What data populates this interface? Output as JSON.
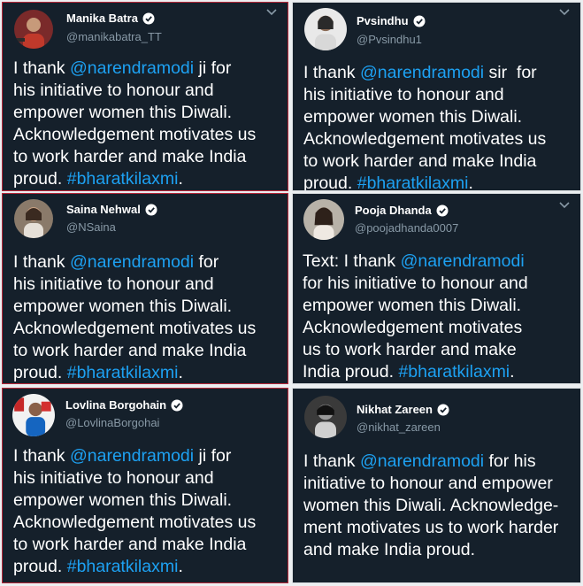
{
  "tweets": [
    {
      "name": "Manika Batra",
      "handle": "@manikabatra_TT",
      "lines": [
        [
          {
            "t": "I thank "
          },
          {
            "t": "@narendramodi",
            "c": "mention"
          },
          {
            "t": " ji for"
          }
        ],
        [
          {
            "t": "his initiative to honour and"
          }
        ],
        [
          {
            "t": "empower women this Diwali."
          }
        ],
        [
          {
            "t": "Acknowledgement motivates us"
          }
        ],
        [
          {
            "t": "to work harder and make India"
          }
        ],
        [
          {
            "t": "proud. "
          },
          {
            "t": "#bharatkilaxmi",
            "c": "hashtag"
          },
          {
            "t": "."
          }
        ]
      ]
    },
    {
      "name": "Pvsindhu",
      "handle": "@Pvsindhu1",
      "lines": [
        [
          {
            "t": "I thank "
          },
          {
            "t": "@narendramodi",
            "c": "mention"
          },
          {
            "t": " sir  for"
          }
        ],
        [
          {
            "t": "his initiative to honour and"
          }
        ],
        [
          {
            "t": "empower women this Diwali."
          }
        ],
        [
          {
            "t": "Acknowledgement motivates us"
          }
        ],
        [
          {
            "t": "to work harder and make India"
          }
        ],
        [
          {
            "t": "proud. "
          },
          {
            "t": "#bharatkilaxmi",
            "c": "hashtag"
          },
          {
            "t": "."
          }
        ]
      ]
    },
    {
      "name": "Saina Nehwal",
      "handle": "@NSaina",
      "lines": [
        [
          {
            "t": "I thank "
          },
          {
            "t": "@narendramodi",
            "c": "mention"
          },
          {
            "t": " for"
          }
        ],
        [
          {
            "t": "his initiative to honour and"
          }
        ],
        [
          {
            "t": "empower women this Diwali."
          }
        ],
        [
          {
            "t": "Acknowledgement motivates us"
          }
        ],
        [
          {
            "t": "to work harder and make India"
          }
        ],
        [
          {
            "t": "proud. "
          },
          {
            "t": "#bharatkilaxmi",
            "c": "hashtag"
          },
          {
            "t": "."
          }
        ]
      ]
    },
    {
      "name": "Pooja Dhanda",
      "handle": "@poojadhanda0007",
      "lines": [
        [
          {
            "t": "Text: I thank "
          },
          {
            "t": "@narendramodi",
            "c": "mention"
          }
        ],
        [
          {
            "t": "for his initiative to honour and"
          }
        ],
        [
          {
            "t": "empower women this Diwali."
          }
        ],
        [
          {
            "t": "Acknowledgement motivates"
          }
        ],
        [
          {
            "t": "us to work harder and make"
          }
        ],
        [
          {
            "t": "India proud. "
          },
          {
            "t": "#bharatkilaxmi",
            "c": "hashtag"
          },
          {
            "t": "."
          }
        ]
      ]
    },
    {
      "name": "Lovlina Borgohain",
      "handle": "@LovlinaBorgohai",
      "lines": [
        [
          {
            "t": "I thank "
          },
          {
            "t": "@narendramodi",
            "c": "mention"
          },
          {
            "t": " ji for"
          }
        ],
        [
          {
            "t": "his initiative to honour and"
          }
        ],
        [
          {
            "t": "empower women this Diwali."
          }
        ],
        [
          {
            "t": "Acknowledgement motivates us"
          }
        ],
        [
          {
            "t": "to work harder and make India"
          }
        ],
        [
          {
            "t": "proud. "
          },
          {
            "t": "#bharatkilaxmi",
            "c": "hashtag"
          },
          {
            "t": "."
          }
        ]
      ]
    },
    {
      "name": "Nikhat Zareen",
      "handle": "@nikhat_zareen",
      "lines": [
        [
          {
            "t": "I thank "
          },
          {
            "t": "@narendramodi",
            "c": "mention"
          },
          {
            "t": " for his"
          }
        ],
        [
          {
            "t": "initiative to honour and empower"
          }
        ],
        [
          {
            "t": "women this Diwali. Acknowledge-"
          }
        ],
        [
          {
            "t": "ment motivates us to work harder"
          }
        ],
        [
          {
            "t": "and make India proud."
          }
        ]
      ]
    }
  ],
  "icons": {
    "verified": "verified-badge-icon",
    "menu": "chevron-down-icon",
    "avatar": "profile-avatar"
  },
  "colors": {
    "background": "#15202b",
    "link": "#1da1f2",
    "secondary": "#8899a6"
  }
}
